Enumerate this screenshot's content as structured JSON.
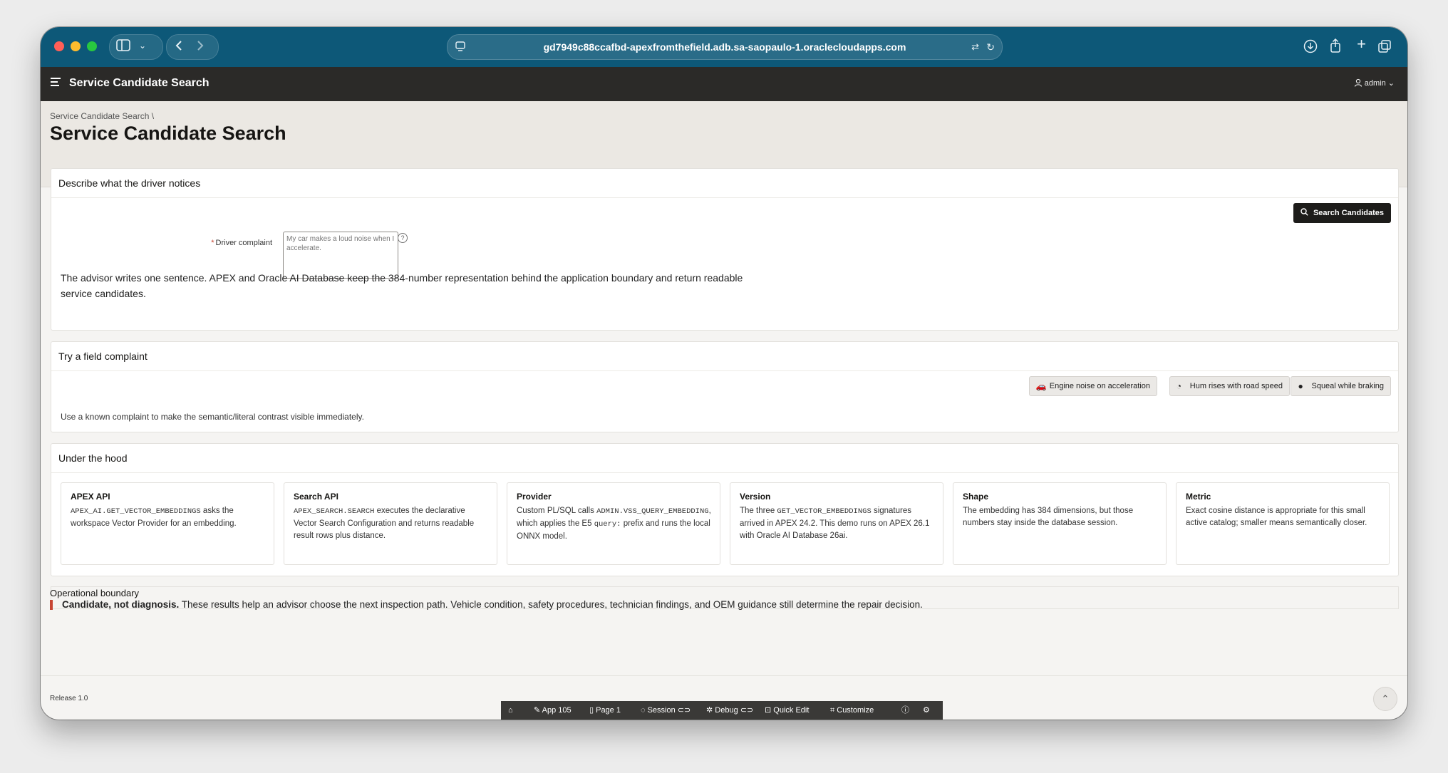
{
  "browser": {
    "url": "gd7949c88ccafbd-apexfromthefield.adb.sa-saopaulo-1.oraclecloudapps.com"
  },
  "header": {
    "app_title": "Service Candidate Search",
    "user": "admin"
  },
  "page": {
    "breadcrumb": "Service Candidate Search",
    "title": "Service Candidate Search"
  },
  "describe_region": {
    "title": "Describe what the driver notices",
    "search_button": "Search Candidates",
    "field_label": "Driver complaint",
    "required_marker": "*",
    "placeholder": "My car makes a loud noise when I accelerate.",
    "advisor_text": "The advisor writes one sentence. APEX and Oracle AI Database keep the 384-number representation behind the application boundary and return readable service candidates."
  },
  "try_region": {
    "title": "Try a field complaint",
    "chips": [
      {
        "label": "Engine noise on acceleration",
        "icon": "car-icon"
      },
      {
        "label": "Hum rises with road speed",
        "icon": "gauge-icon"
      },
      {
        "label": "Squeal while braking",
        "icon": "alert-icon"
      }
    ],
    "help_text": "Use a known complaint to make the semantic/literal contrast visible immediately."
  },
  "hood_region": {
    "title": "Under the hood",
    "cards": [
      {
        "title": "APEX API",
        "code": "APEX_AI.GET_VECTOR_EMBEDDINGS",
        "text": " asks the workspace Vector Provider for an embedding."
      },
      {
        "title": "Search API",
        "code": "APEX_SEARCH.SEARCH",
        "text": " executes the declarative Vector Search Configuration and returns readable result rows plus distance."
      },
      {
        "title": "Provider",
        "pre": "Custom PL/SQL calls ",
        "code": "ADMIN.VSS_QUERY_EMBEDDING",
        "mid": ", which applies the E5 ",
        "code2": "query:",
        "text": " prefix and runs the local ONNX model."
      },
      {
        "title": "Version",
        "pre": "The three ",
        "code": "GET_VECTOR_EMBEDDINGS",
        "text": " signatures arrived in APEX 24.2. This demo runs on APEX 26.1 with Oracle AI Database 26ai."
      },
      {
        "title": "Shape",
        "text": "The embedding has 384 dimensions, but those numbers stay inside the database session."
      },
      {
        "title": "Metric",
        "text": "Exact cosine distance is appropriate for this small active catalog; smaller means semantically closer."
      }
    ]
  },
  "boundary": {
    "label": "Operational boundary",
    "strong": "Candidate, not diagnosis.",
    "text": " These results help an advisor choose the next inspection path. Vehicle condition, safety procedures, technician findings, and OEM guidance still determine the repair decision."
  },
  "footer": {
    "release": "Release 1.0"
  },
  "dev_toolbar": {
    "app": "App 105",
    "page": "Page 1",
    "session": "Session",
    "debug": "Debug",
    "quick_edit": "Quick Edit",
    "customize": "Customize"
  }
}
